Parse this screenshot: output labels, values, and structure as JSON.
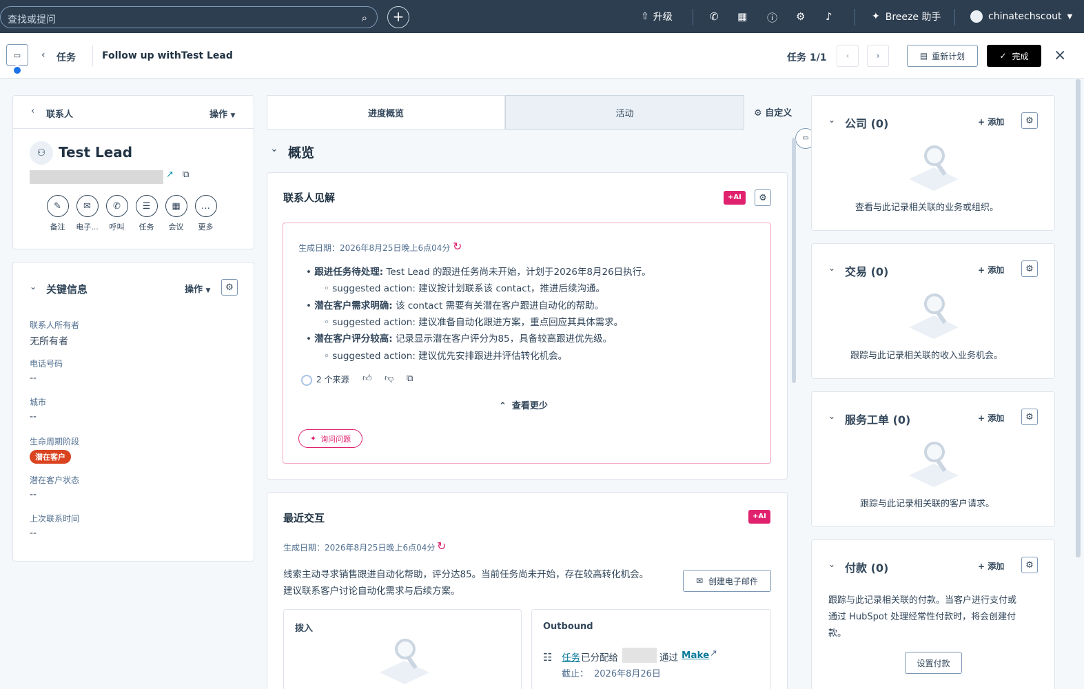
{
  "topbar": {
    "search_placeholder": "查找或提问",
    "upgrade": "升级",
    "breeze": "Breeze 助手",
    "account": "chinatechscout"
  },
  "subheader": {
    "back": "任务",
    "title": "Follow up withTest Lead",
    "task_count": "任务 1/1",
    "reschedule": "重新计划",
    "done": "完成"
  },
  "contact": {
    "back": "联系人",
    "actions": "操作",
    "name": "Test Lead",
    "quick_actions": [
      "备注",
      "电子...",
      "呼叫",
      "任务",
      "会议",
      "更多"
    ]
  },
  "key_info": {
    "title": "关键信息",
    "actions": "操作",
    "fields": [
      {
        "label": "联系人所有者",
        "value": "无所有者"
      },
      {
        "label": "电话号码",
        "value": "--"
      },
      {
        "label": "城市",
        "value": "--"
      },
      {
        "label": "生命周期阶段",
        "value": "潜在客户"
      },
      {
        "label": "潜在客户状态",
        "value": "--"
      },
      {
        "label": "上次联系时间",
        "value": "--"
      }
    ]
  },
  "tabs": {
    "overview": "进度概览",
    "activity": "活动",
    "customize": "自定义"
  },
  "overview": {
    "section": "概览"
  },
  "insights": {
    "title": "联系人见解",
    "ai": "+AI",
    "generated": "生成日期：2026年8月25日晚上6点04分",
    "bullets": [
      {
        "bold": "跟进任务待处理:",
        "text": " Test Lead 的跟进任务尚未开始，计划于2026年8月26日执行。",
        "sub": "suggested action: 建议按计划联系该 contact，推进后续沟通。"
      },
      {
        "bold": "潜在客户需求明确:",
        "text": " 该 contact 需要有关潜在客户跟进自动化的帮助。",
        "sub": "suggested action: 建议准备自动化跟进方案，重点回应其具体需求。"
      },
      {
        "bold": "潜在客户评分较高:",
        "text": " 记录显示潜在客户评分为85，具备较高跟进优先级。",
        "sub": "suggested action: 建议优先安排跟进并评估转化机会。"
      }
    ],
    "sources": "2 个来源",
    "see_less": "查看更少",
    "ask": "询问问题"
  },
  "recent": {
    "title": "最近交互",
    "ai": "+AI",
    "generated": "生成日期：2026年8月25日晚上6点04分",
    "line1": "线索主动寻求销售跟进自动化帮助，评分达85。当前任务尚未开始，存在较高转化机会。",
    "line2": "建议联系客户讨论自动化需求与后续方案。",
    "create_email": "创建电子邮件",
    "inbound": "拨入",
    "outbound": "Outbound",
    "task_link": "任务",
    "assigned": "已分配给",
    "via": "通过",
    "make": "Make",
    "due_label": "截止：",
    "due": "2026年8月26日"
  },
  "right": [
    {
      "title": "公司 (0)",
      "add": "添加",
      "desc": "查看与此记录相关联的业务或组织。"
    },
    {
      "title": "交易 (0)",
      "add": "添加",
      "desc": "跟踪与此记录相关联的收入业务机会。"
    },
    {
      "title": "服务工单 (0)",
      "add": "添加",
      "desc": "跟踪与此记录相关联的客户请求。"
    },
    {
      "title": "付款 (0)",
      "add": "添加",
      "desc1": "跟踪与此记录相关联的付款。当客户进行支付或",
      "desc2": "通过 HubSpot 处理经常性付款时，将会创建付",
      "desc3": "款。",
      "setup": "设置付款"
    }
  ],
  "colors": {
    "topbar": "#2d3e50",
    "ai": "#e0226e",
    "lifecycle": "#d9431f",
    "link": "#0b7a9a"
  }
}
